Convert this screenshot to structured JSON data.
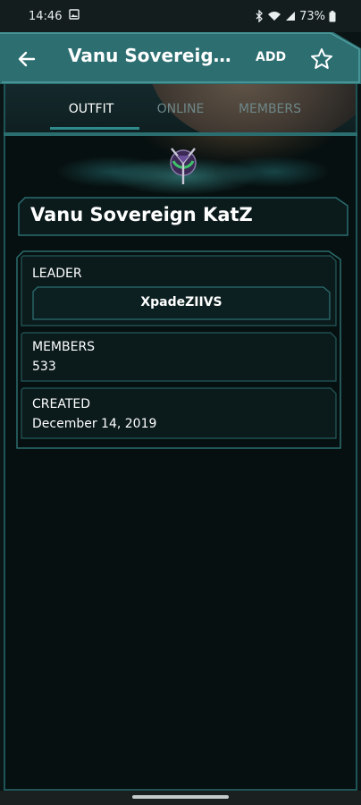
{
  "status_bar": {
    "time": "14:46",
    "battery": "73%"
  },
  "app_bar": {
    "title": "Vanu Sovereign KatZ",
    "add_label": "ADD"
  },
  "tabs": [
    {
      "label": "OUTFIT",
      "active": true
    },
    {
      "label": "ONLINE",
      "active": false
    },
    {
      "label": "MEMBERS",
      "active": false
    }
  ],
  "outfit": {
    "name": "Vanu Sovereign KatZ",
    "leader_label": "LEADER",
    "leader": "XpadeZIIVS",
    "members_label": "MEMBERS",
    "members": "533",
    "created_label": "CREATED",
    "created": "December 14, 2019"
  },
  "colors": {
    "accent": "#2f8a8c",
    "frame": "#1f5457",
    "background": "#071010",
    "appbar": "#2d6e71"
  }
}
